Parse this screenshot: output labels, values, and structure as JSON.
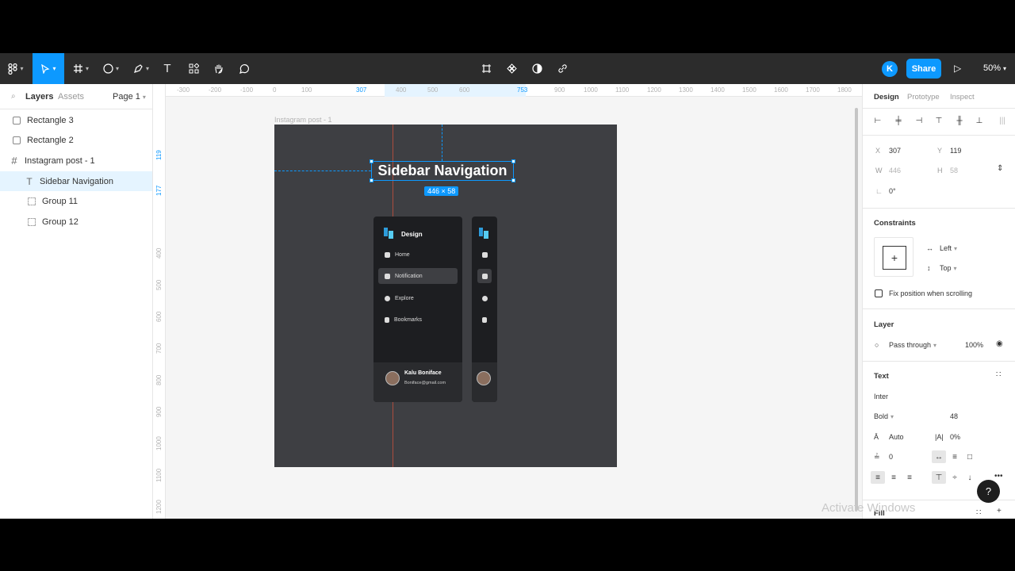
{
  "toolbar": {
    "tools": [
      "figma-menu",
      "move-tool",
      "frame-tool",
      "shape-tool",
      "pen-tool",
      "text-tool",
      "resources-tool",
      "hand-tool",
      "comment-tool"
    ],
    "text_tool_glyph": "T",
    "avatar_initial": "K",
    "share_label": "Share",
    "zoom_label": "50%"
  },
  "left_panel": {
    "tab_layers": "Layers",
    "tab_assets": "Assets",
    "page_label": "Page 1",
    "layers": [
      {
        "name": "Rectangle 3"
      },
      {
        "name": "Rectangle 2"
      },
      {
        "name": "Instagram post - 1"
      },
      {
        "name": "Sidebar Navigation"
      },
      {
        "name": "Group 11"
      },
      {
        "name": "Group 12"
      }
    ]
  },
  "canvas": {
    "ruler_top": [
      "-300",
      "-200",
      "-100",
      "0",
      "100",
      "307",
      "400",
      "500",
      "600",
      "753",
      "900",
      "1000",
      "1100",
      "1200",
      "1300",
      "1400",
      "1500",
      "1600",
      "1700",
      "1800"
    ],
    "ruler_left": [
      "119",
      "177",
      "400",
      "500",
      "600",
      "700",
      "800",
      "900",
      "1000",
      "1100",
      "1200"
    ],
    "frame_label": "Instagram post - 1",
    "title_text": "Sidebar Navigation",
    "size_badge": "446 × 58",
    "sidebar": {
      "brand": "Design",
      "items": [
        "Home",
        "Notification",
        "Explore",
        "Bookmarks"
      ],
      "active_index": 1,
      "user_name": "Kalu Boniface",
      "user_email": "Boniface@gmail.com"
    }
  },
  "right_panel": {
    "tabs": [
      "Design",
      "Prototype",
      "Inspect"
    ],
    "x_label": "X",
    "x_value": "307",
    "y_label": "Y",
    "y_value": "119",
    "w_label": "W",
    "w_value": "446",
    "h_label": "H",
    "h_value": "58",
    "rotation": "0°",
    "constraints_title": "Constraints",
    "constraint_h": "Left",
    "constraint_v": "Top",
    "fix_position_label": "Fix position when scrolling",
    "layer_title": "Layer",
    "blend_mode": "Pass through",
    "opacity": "100%",
    "text_title": "Text",
    "font_family": "Inter",
    "font_weight": "Bold",
    "font_size": "48",
    "line_height": "Auto",
    "letter_spacing_icon": "|A|",
    "letter_spacing": "0%",
    "paragraph_spacing": "0",
    "fill_title": "Fill"
  },
  "overlay": {
    "help": "?",
    "watermark": "Activate Windows"
  },
  "colors": {
    "accent": "#0d99ff",
    "toolbar_bg": "#2c2c2c",
    "frame_bg": "#3e3f43",
    "sidebar_bg": "#1d1e21"
  }
}
